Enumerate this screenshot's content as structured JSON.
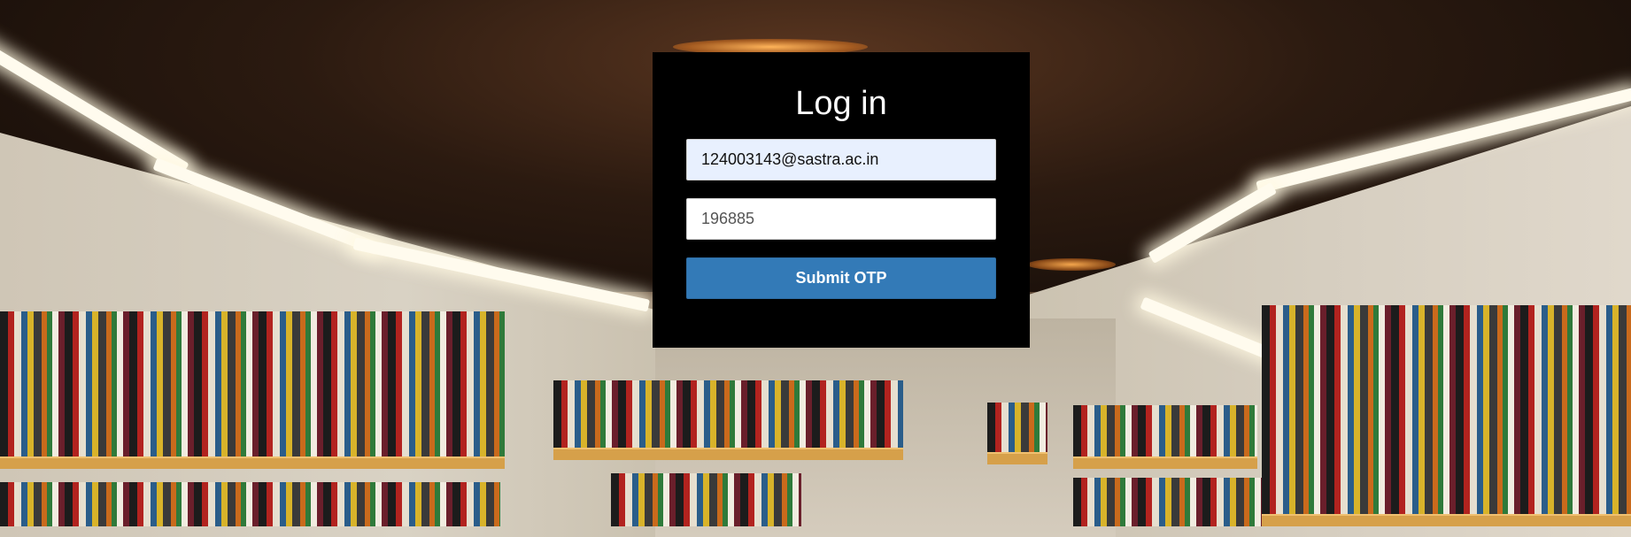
{
  "login": {
    "title": "Log in",
    "email_value": "124003143@sastra.ac.in",
    "otp_value": "196885",
    "submit_label": "Submit OTP"
  },
  "colors": {
    "dialog_bg": "#000000",
    "email_field_bg": "#e8f0fe",
    "button_bg": "#337ab7",
    "button_text": "#ffffff"
  }
}
